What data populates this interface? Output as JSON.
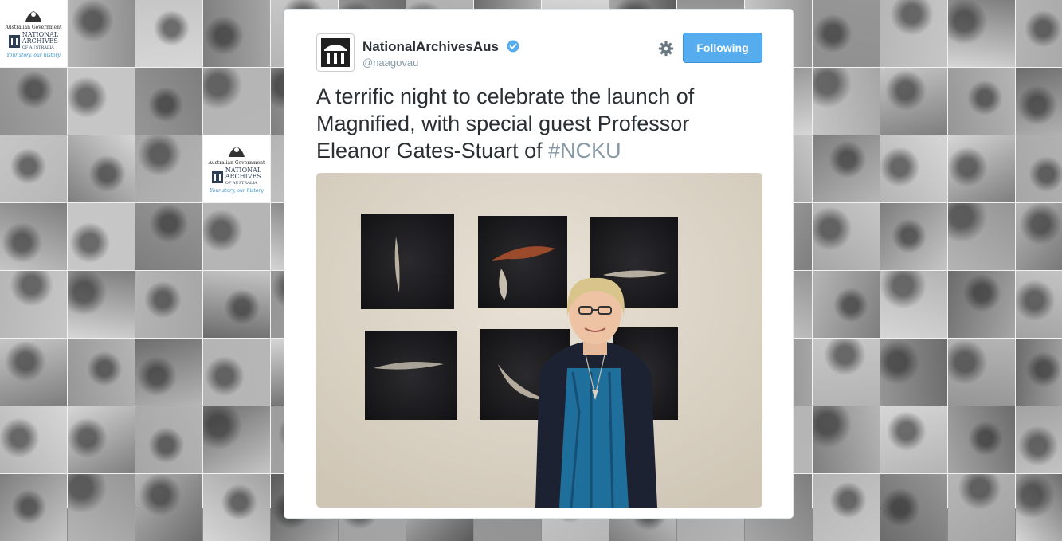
{
  "brand": {
    "government": "Australian Government",
    "name_line1": "NATIONAL",
    "name_line2": "ARCHIVES",
    "name_line3": "OF AUSTRALIA",
    "tagline": "Your story, our history"
  },
  "tweet": {
    "display_name": "NationalArchivesAus",
    "handle": "@naagovau",
    "follow_button_label": "Following",
    "text": "A terrific night to celebrate the launch of Magnified, with special guest Professor Eleanor Gates-Stuart of ",
    "hashtag": "#NCKU"
  },
  "icons": {
    "verified": "verified-badge-icon",
    "settings": "gear-icon",
    "avatar": "national-archives-building-icon"
  },
  "colors": {
    "accent": "#55acee",
    "text": "#292f33",
    "muted": "#8899a6",
    "brand_navy": "#2d3e55"
  }
}
